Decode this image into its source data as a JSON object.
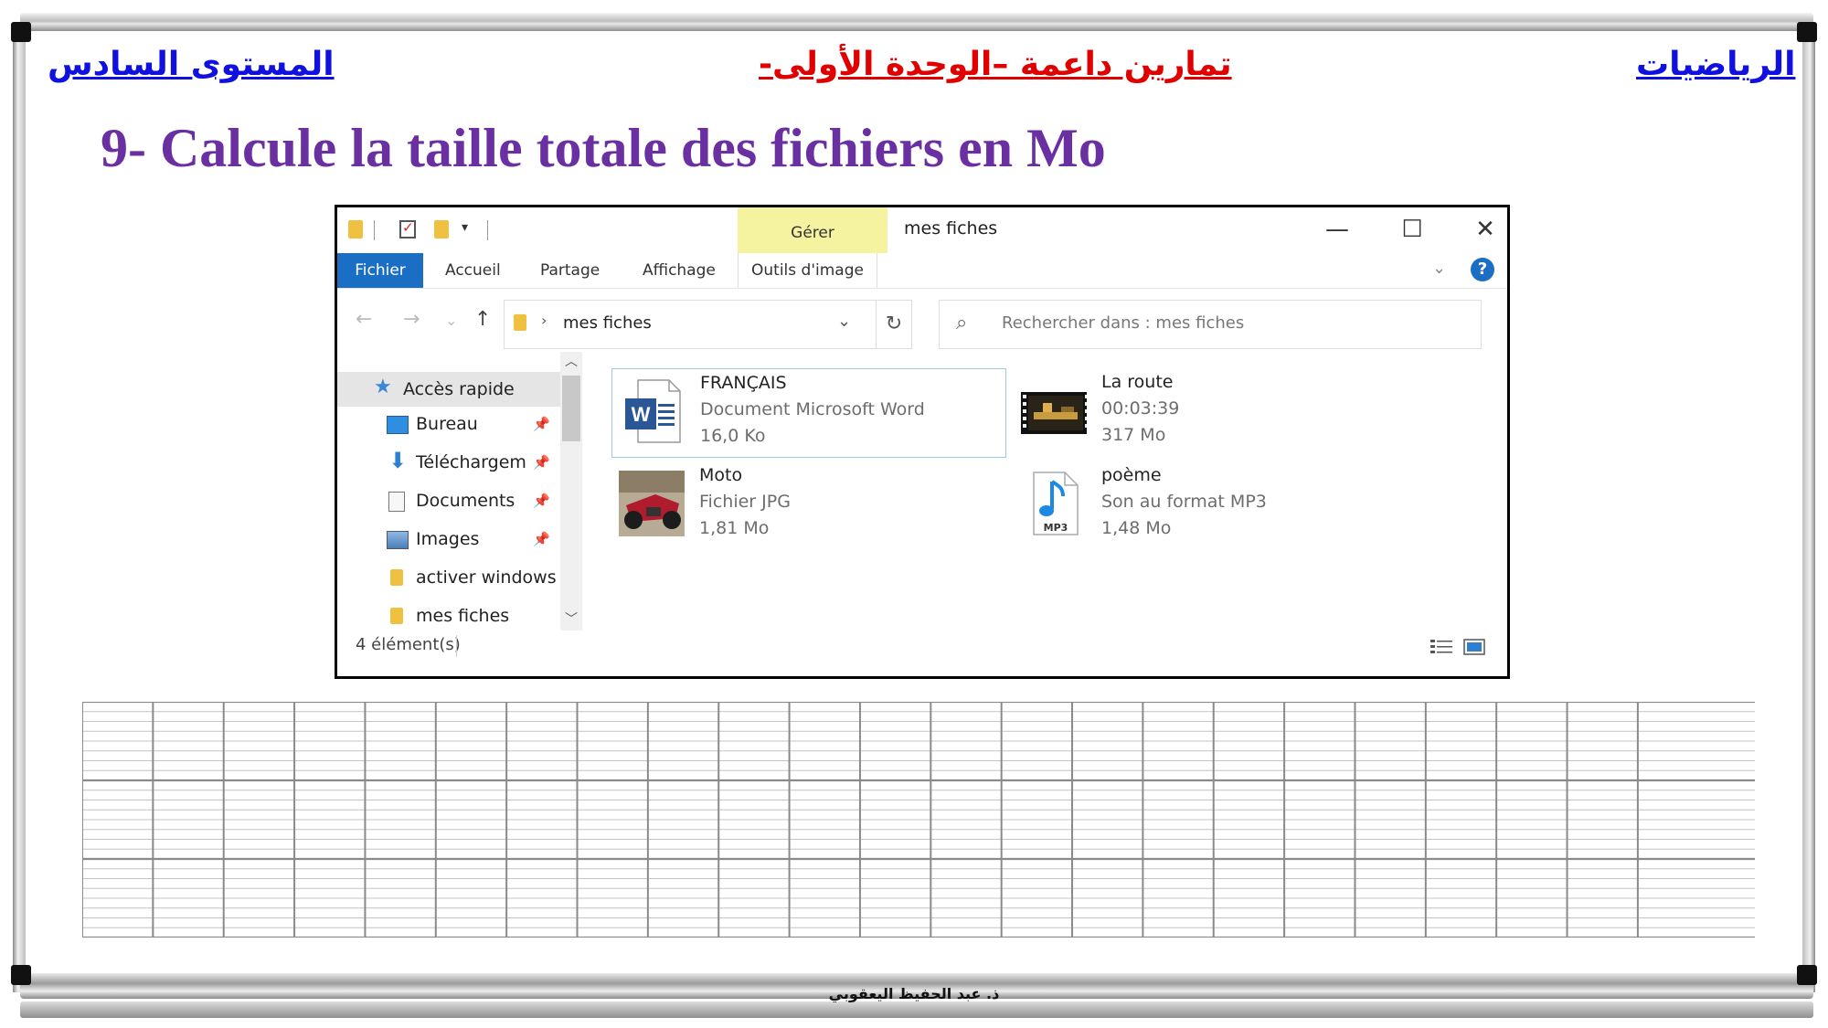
{
  "header": {
    "subject": "الرياضيات",
    "unit": "تمارين داعمة –الوحدة الأولى-",
    "level": "المستوى السادس"
  },
  "exercise": {
    "title": "9- Calcule la taille totale des fichiers en Mo"
  },
  "explorer": {
    "context_tab": "Gérer",
    "window_title": "mes fiches",
    "controls": {
      "minimize": "—",
      "maximize": "☐",
      "close": "✕"
    },
    "ribbon_tabs": [
      "Fichier",
      "Accueil",
      "Partage",
      "Affichage",
      "Outils d'image"
    ],
    "address": "mes fiches",
    "search_placeholder": "Rechercher dans : mes fiches",
    "nav_items": [
      {
        "label": "Accès rapide",
        "icon": "star-icon"
      },
      {
        "label": "Bureau",
        "icon": "desktop-icon"
      },
      {
        "label": "Téléchargem",
        "icon": "download-icon"
      },
      {
        "label": "Documents",
        "icon": "document-icon"
      },
      {
        "label": "Images",
        "icon": "image-icon"
      },
      {
        "label": "activer windows",
        "icon": "folder-icon"
      },
      {
        "label": "mes fiches",
        "icon": "folder-icon"
      }
    ],
    "files": [
      {
        "name": "FRANÇAIS",
        "type": "Document Microsoft Word",
        "size": "16,0 Ko",
        "icon": "word-icon"
      },
      {
        "name": "La route",
        "type": "00:03:39",
        "size": "317 Mo",
        "icon": "video-thumbnail"
      },
      {
        "name": "Moto",
        "type": "Fichier JPG",
        "size": "1,81 Mo",
        "icon": "photo-thumbnail"
      },
      {
        "name": "poème",
        "type": "Son au format MP3",
        "size": "1,48 Mo",
        "icon": "mp3-icon"
      }
    ],
    "mp3_badge": "MP3",
    "word_badge": "W",
    "status": "4 élément(s)"
  },
  "footer": {
    "author": "ذ. عبد الحفيظ اليعقوبي"
  },
  "colors": {
    "header_blue": "#1010e0",
    "header_red": "#e00000",
    "title_purple": "#6a2fa0",
    "file_tab_blue": "#1a6fc4",
    "manage_tab_yellow": "#f5f3a0"
  }
}
